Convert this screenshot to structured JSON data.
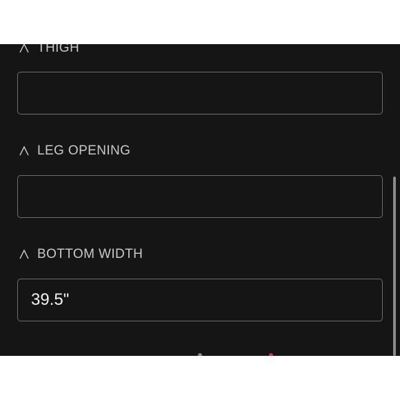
{
  "fields": [
    {
      "label": "THIGH",
      "value": "",
      "icon": "measure-icon"
    },
    {
      "label": "LEG OPENING",
      "value": "",
      "icon": "measure-icon"
    },
    {
      "label": "BOTTOM WIDTH",
      "value": "39.5\"",
      "icon": "measure-icon"
    }
  ],
  "colors": {
    "panel_background": "#151515",
    "field_border": "#6d6d6d",
    "label_text": "#c9c9c9",
    "value_text": "#f2f2f2",
    "scrollbar": "#8a8a8a",
    "accent": "#e0284a"
  }
}
